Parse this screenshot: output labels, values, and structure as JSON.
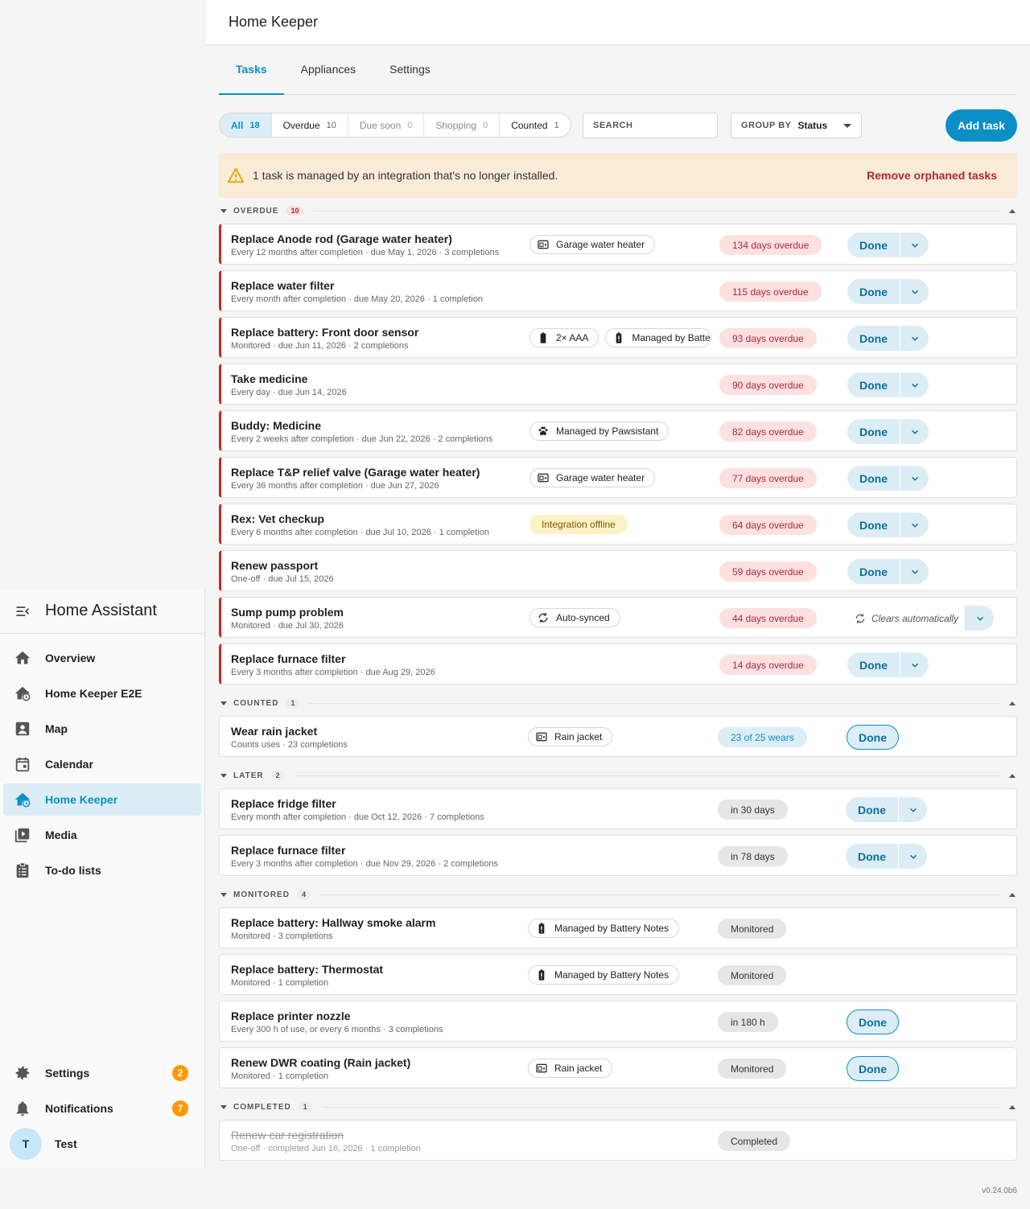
{
  "app": {
    "title": "Home Keeper",
    "version": "v0.24.0b6"
  },
  "sidebar": {
    "title": "Home Assistant",
    "items": [
      {
        "label": "Overview",
        "icon": "home-icon"
      },
      {
        "label": "Home Keeper E2E",
        "icon": "home-clock-icon"
      },
      {
        "label": "Map",
        "icon": "map-icon"
      },
      {
        "label": "Calendar",
        "icon": "calendar-icon"
      },
      {
        "label": "Home Keeper",
        "icon": "home-clock-icon",
        "active": true
      },
      {
        "label": "Media",
        "icon": "media-icon"
      },
      {
        "label": "To-do lists",
        "icon": "clipboard-list-icon"
      }
    ],
    "settings": {
      "label": "Settings",
      "badge": "2"
    },
    "notifications": {
      "label": "Notifications",
      "badge": "7"
    },
    "user": {
      "initial": "T",
      "name": "Test"
    }
  },
  "tabs": [
    {
      "label": "Tasks",
      "active": true
    },
    {
      "label": "Appliances"
    },
    {
      "label": "Settings"
    }
  ],
  "filters": [
    {
      "label": "All",
      "count": "18",
      "active": true
    },
    {
      "label": "Overdue",
      "count": "10"
    },
    {
      "label": "Due soon",
      "count": "0",
      "dim": true
    },
    {
      "label": "Shopping",
      "count": "0",
      "dim": true
    },
    {
      "label": "Counted",
      "count": "1"
    }
  ],
  "search": {
    "label": "SEARCH"
  },
  "group_by": {
    "label": "GROUP BY",
    "value": "Status"
  },
  "add_task": "Add task",
  "warning": {
    "text": "1 task is managed by an integration that's no longer installed.",
    "action": "Remove orphaned tasks"
  },
  "done_label": "Done",
  "clears_label": "Clears automatically",
  "sections": [
    {
      "name": "OVERDUE",
      "count": "10",
      "kind": "overdue",
      "tasks": [
        {
          "title": "Replace Anode rod (Garage water heater)",
          "subtitle": "Every 12 months after completion · due May 1, 2026 · 3 completions",
          "chips": [
            {
              "icon": "appliance",
              "text": "Garage water heater"
            }
          ],
          "status": "134 days overdue",
          "action": "split"
        },
        {
          "title": "Replace water filter",
          "subtitle": "Every month after completion · due May 20, 2026 · 1 completion",
          "chips": [],
          "status": "115 days overdue",
          "action": "split"
        },
        {
          "title": "Replace battery: Front door sensor",
          "subtitle": "Monitored · due Jun 11, 2026 · 2 completions",
          "chips": [
            {
              "icon": "battery",
              "text": "2× AAA"
            },
            {
              "icon": "battery-alert",
              "text": "Managed by Battery Notes",
              "clip": true
            }
          ],
          "status": "93 days overdue",
          "action": "split"
        },
        {
          "title": "Take medicine",
          "subtitle": "Every day · due Jun 14, 2026",
          "chips": [],
          "status": "90 days overdue",
          "action": "split"
        },
        {
          "title": "Buddy: Medicine",
          "subtitle": "Every 2 weeks after completion · due Jun 22, 2026 · 2 completions",
          "chips": [
            {
              "icon": "paw",
              "text": "Managed by Pawsistant"
            }
          ],
          "status": "82 days overdue",
          "action": "split"
        },
        {
          "title": "Replace T&P relief valve (Garage water heater)",
          "subtitle": "Every 36 months after completion · due Jun 27, 2026",
          "chips": [
            {
              "icon": "appliance",
              "text": "Garage water heater"
            }
          ],
          "status": "77 days overdue",
          "action": "split"
        },
        {
          "title": "Rex: Vet checkup",
          "subtitle": "Every 6 months after completion · due Jul 10, 2026 · 1 completion",
          "chips": [
            {
              "icon": "",
              "text": "Integration offline",
              "yellow": true
            }
          ],
          "status": "64 days overdue",
          "action": "split"
        },
        {
          "title": "Renew passport",
          "subtitle": "One-off · due Jul 15, 2026",
          "chips": [],
          "status": "59 days overdue",
          "action": "split"
        },
        {
          "title": "Sump pump problem",
          "subtitle": "Monitored · due Jul 30, 2026",
          "chips": [
            {
              "icon": "sync",
              "text": "Auto-synced"
            }
          ],
          "status": "44 days overdue",
          "action": "clears"
        },
        {
          "title": "Replace furnace filter",
          "subtitle": "Every 3 months after completion · due Aug 29, 2026",
          "chips": [],
          "status": "14 days overdue",
          "action": "split"
        }
      ]
    },
    {
      "name": "COUNTED",
      "count": "1",
      "kind": "counted",
      "tasks": [
        {
          "title": "Wear rain jacket",
          "subtitle": "Counts uses · 23 completions",
          "chips": [
            {
              "icon": "appliance",
              "text": "Rain jacket"
            }
          ],
          "status": "23 of 25 wears",
          "action": "solo"
        }
      ]
    },
    {
      "name": "LATER",
      "count": "2",
      "kind": "later",
      "tasks": [
        {
          "title": "Replace fridge filter",
          "subtitle": "Every month after completion · due Oct 12, 2026 · 7 completions",
          "chips": [],
          "status": "in 30 days",
          "action": "split"
        },
        {
          "title": "Replace furnace filter",
          "subtitle": "Every 3 months after completion · due Nov 29, 2026 · 2 completions",
          "chips": [],
          "status": "in 78 days",
          "action": "split"
        }
      ]
    },
    {
      "name": "MONITORED",
      "count": "4",
      "kind": "monitored",
      "tasks": [
        {
          "title": "Replace battery: Hallway smoke alarm",
          "subtitle": "Monitored · 3 completions",
          "chips": [
            {
              "icon": "battery-alert",
              "text": "Managed by Battery Notes"
            }
          ],
          "status": "Monitored",
          "action": "none"
        },
        {
          "title": "Replace battery: Thermostat",
          "subtitle": "Monitored · 1 completion",
          "chips": [
            {
              "icon": "battery-alert",
              "text": "Managed by Battery Notes"
            }
          ],
          "status": "Monitored",
          "action": "none"
        },
        {
          "title": "Replace printer nozzle",
          "subtitle": "Every 300 h of use, or every 6 months · 3 completions",
          "chips": [],
          "status": "in 180 h",
          "action": "solo"
        },
        {
          "title": "Renew DWR coating (Rain jacket)",
          "subtitle": "Monitored · 1 completion",
          "chips": [
            {
              "icon": "appliance",
              "text": "Rain jacket"
            }
          ],
          "status": "Monitored",
          "action": "solo"
        }
      ]
    },
    {
      "name": "COMPLETED",
      "count": "1",
      "kind": "completed",
      "tasks": [
        {
          "title": "Renew car registration",
          "subtitle": "One-off · completed Jun 16, 2026 · 1 completion",
          "chips": [],
          "status": "Completed",
          "action": "none"
        }
      ]
    }
  ]
}
